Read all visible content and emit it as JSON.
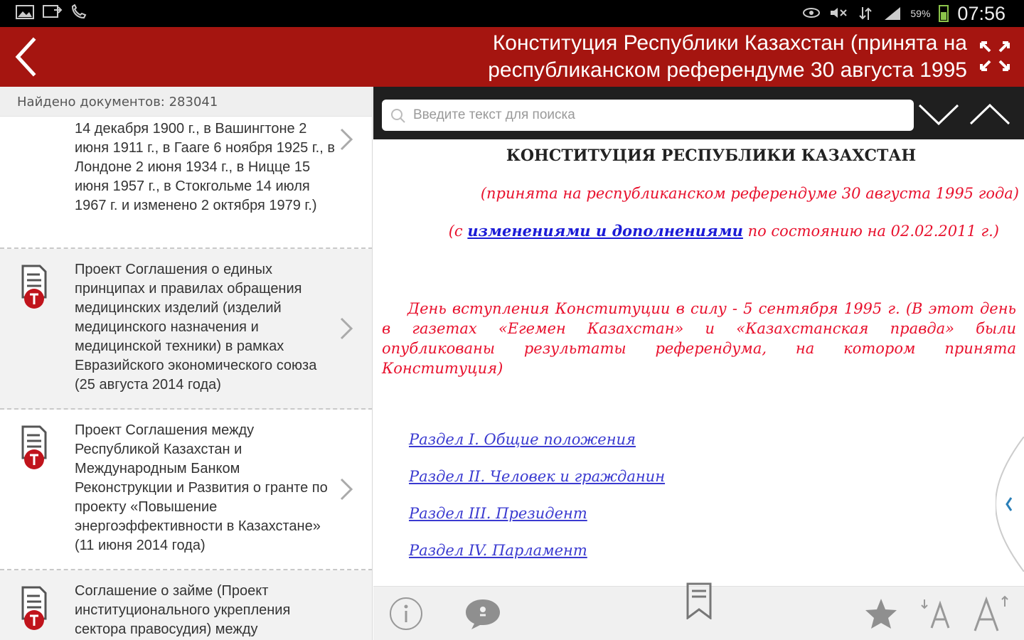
{
  "status_bar": {
    "battery_percent": "59%",
    "time": "07:56",
    "icons_left": [
      "gallery-icon",
      "screen-mirror-icon",
      "call-icon"
    ],
    "icons_right": [
      "eye-icon",
      "mute-icon",
      "data-arrows-icon",
      "signal-icon",
      "battery-icon"
    ]
  },
  "action_bar": {
    "title_line1": "Конституция Республики Казахстан (принята на",
    "title_line2": "республиканском референдуме 30 августа 1995",
    "accent_color": "#a51510"
  },
  "left_panel": {
    "found_text": "Найдено документов: 283041",
    "items": [
      {
        "text": "14 декабря 1900 г., в Вашингтоне 2 июня 1911 г., в Гааге 6 ноября 1925 г., в Лондоне 2 июня 1934 г., в Ницце 15 июня 1957 г., в Стокгольме 14 июля 1967 г. и изменено 2 октября 1979 г.)",
        "icon": null
      },
      {
        "text": "Проект Соглашения о единых принципах и правилах обращения медицинских изделий (изделий медицинского назначения и медицинской техники) в рамках Евразийского экономического союза (25 августа 2014 года)",
        "icon": "document-icon"
      },
      {
        "text": "Проект Соглашения между Республикой Казахстан и Международным Банком Реконструкции и Развития о гранте по проекту «Повышение энергоэффективности в Казахстане» (11 июня 2014 года)",
        "icon": "document-icon"
      },
      {
        "text": "Соглашение о займе (Проект институционального укрепления сектора правосудия) между",
        "icon": "document-icon"
      }
    ]
  },
  "search": {
    "placeholder": "Введите текст для поиска"
  },
  "document": {
    "heading": "КОНСТИТУЦИЯ РЕСПУБЛИКИ КАЗАХСТАН",
    "subtitle": "(принята на республиканском референдуме 30 августа 1995 года)",
    "changes_prefix": "(с ",
    "changes_link": "изменениями и дополнениями",
    "changes_suffix": " по состоянию на 02.02.2011 г.)",
    "paragraph": "День вступления Конституции в силу - 5 сентября 1995 г. (В этот день в газетах «Егемен Казахстан» и «Казахстанская правда» были опубликованы результаты референдума, на котором принята Конституция)",
    "toc": [
      "Раздел I. Общие положения",
      "Раздел II. Человек и гражданин",
      "Раздел III. Президент",
      "Раздел IV. Парламент"
    ],
    "text_color": "#e8112d",
    "link_color": "#3a3ad0"
  },
  "toolbar": {
    "buttons": [
      "info-icon",
      "comment-icon",
      "bookmark-icon",
      "star-icon",
      "decrease-font-icon",
      "increase-font-icon"
    ]
  }
}
